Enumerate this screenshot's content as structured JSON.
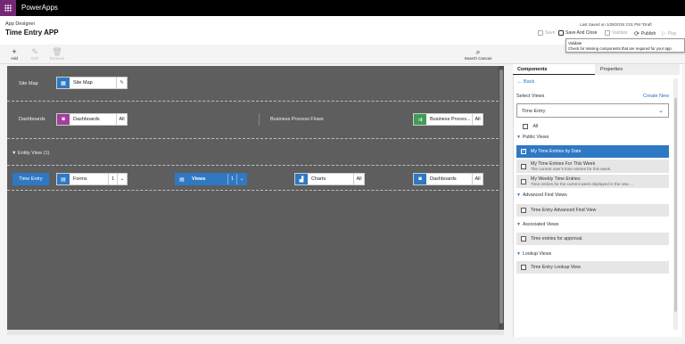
{
  "topbar": {
    "brand": "PowerApps"
  },
  "header": {
    "app_label": "App Designer",
    "app_title": "Time Entry APP",
    "last_saved": "Last Saved on 1/28/2019 3:01 PM *Draft",
    "commands": {
      "save": "Save",
      "save_and_close": "Save And Close",
      "validate": "Validate",
      "publish": "Publish",
      "play": "Play"
    }
  },
  "tooltip": {
    "title": "Validate",
    "text": "Check for missing components that are required for your app."
  },
  "toolbar": {
    "add": "Add",
    "edit": "Edit",
    "remove": "Remove",
    "search_canvas": "Search Canvas"
  },
  "canvas": {
    "site_map_label": "Site Map",
    "site_map_tile": "Site Map",
    "dashboards_label": "Dashboards",
    "dashboards_tile": "Dashboards",
    "dashboards_all": "All",
    "bpf_label": "Business Process Flows",
    "bpf_tile": "Business Proces...",
    "bpf_all": "All",
    "entity_view_label": "Entity View (1)",
    "entity_button": "Time Entry",
    "forms_tile": "Forms",
    "forms_count": "1",
    "views_tile": "Views",
    "views_count": "1",
    "charts_tile": "Charts",
    "charts_all": "All",
    "entity_dashboards_tile": "Dashboards",
    "entity_dashboards_all": "All"
  },
  "panel": {
    "tab_components": "Components",
    "tab_properties": "Properties",
    "back": "Back",
    "select_views": "Select Views",
    "create_new": "Create New",
    "entity_select": "Time Entry",
    "all": "All",
    "groups": {
      "public": "Public Views",
      "advanced": "Advanced Find Views",
      "associated": "Associated Views",
      "lookup": "Lookup Views"
    },
    "public_views": [
      {
        "title": "My Time Entries by Date",
        "subtitle": ""
      },
      {
        "title": "My Time Entries For This Week",
        "subtitle": "The current user's time entries for this week."
      },
      {
        "title": "My Weekly Time Entries",
        "subtitle": "Time entries for the current week displayed in the new ..."
      }
    ],
    "advanced_view": "Time Entry Advanced Find View",
    "associated_view": "Time entries for approval.",
    "lookup_view": "Time Entry Lookup View"
  },
  "colors": {
    "accent": "#2f78c4",
    "brand": "#742774",
    "canvas": "#5e5e5e"
  }
}
